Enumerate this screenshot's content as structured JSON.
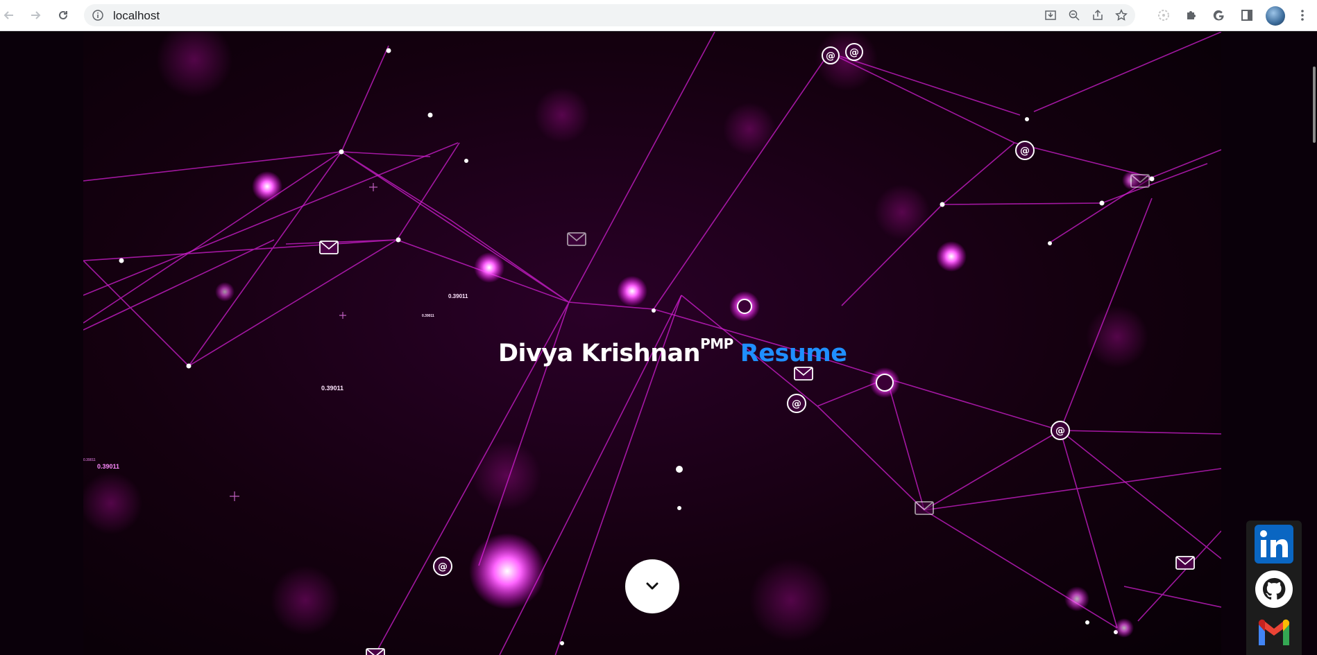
{
  "browser": {
    "url": "localhost",
    "icons": [
      "back-icon",
      "forward-icon",
      "reload-icon",
      "info-icon",
      "install-icon",
      "zoom-icon",
      "share-icon",
      "bookmark-star-icon",
      "extension-icon",
      "puzzle-icon",
      "google-icon",
      "side-panel-icon",
      "avatar",
      "menu-icon"
    ]
  },
  "hero": {
    "name": "Divya Krishnan",
    "credential": "PMP",
    "accent_word": "Resume",
    "accent_color": "#1f8fff",
    "background_labels": [
      "0.39011",
      "0.39011",
      "0.39011",
      "0.39011",
      "0.39011"
    ]
  },
  "scroll_button": {
    "icon": "chevron-down-icon"
  },
  "social": {
    "links": [
      {
        "name": "LinkedIn",
        "icon": "linkedin-icon",
        "color": "#0a66c2"
      },
      {
        "name": "GitHub",
        "icon": "github-icon",
        "color": "#ffffff"
      },
      {
        "name": "Gmail",
        "icon": "gmail-icon",
        "color": "#ea4335"
      }
    ]
  }
}
